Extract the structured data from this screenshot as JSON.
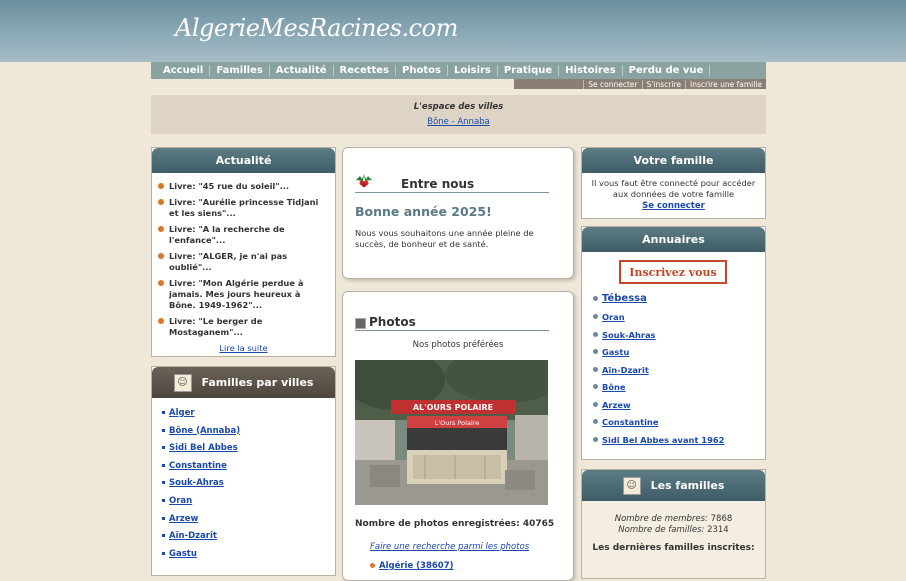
{
  "site": {
    "logo": "AlgerieMesRacines.com"
  },
  "nav": {
    "items": [
      "Accueil",
      "Familles",
      "Actualité",
      "Recettes",
      "Photos",
      "Loisirs",
      "Pratique",
      "Histoires",
      "Perdu de vue"
    ],
    "sub_items": [
      "Se connecter",
      "S'inscrire",
      "Inscrire une famille"
    ]
  },
  "city_band": {
    "title": "L'espace des villes",
    "link": "Bône - Annaba"
  },
  "actualite": {
    "title": "Actualité",
    "items": [
      "Livre: \"45 rue du soleil\"...",
      "Livre: \"Aurélie princesse Tidjani et les siens\"...",
      "Livre: \"A la recherche de l'enfance\"...",
      "Livre: \"ALGER, je n'ai pas oublié\"...",
      "Livre: \"Mon Algérie perdue à jamais. Mes jours heureux à Bône. 1949-1962\"...",
      "Livre: \"Le berger de Mostaganem\"..."
    ],
    "read_more": "Lire la suite"
  },
  "familles_villes": {
    "title": "Familles par villes",
    "items": [
      "Alger",
      "Bône (Annaba)",
      "Sidi Bel Abbes",
      "Constantine",
      "Souk-Ahras",
      "Oran",
      "Arzew",
      "Aïn-Dzarit",
      "Gastu"
    ]
  },
  "entre_nous": {
    "title": "Entre nous",
    "heading": "Bonne année 2025!",
    "text": "Nous vous souhaitons une année pleine de succès, de bonheur et de santé."
  },
  "photos": {
    "title": "Photos",
    "subtitle": "Nos photos préférées",
    "sign_top": "AL'OURS POLAIRE",
    "sign_mid": "L'Ours Polaire",
    "count_label": "Nombre de photos enregistrées: 40765",
    "search_link": "Faire une recherche parmi les photos",
    "region": "Algérie (38607)"
  },
  "votre_famille": {
    "title": "Votre famille",
    "text": "Il vous faut être connecté pour accéder aux données de votre famille",
    "link": "Se connecter"
  },
  "annuaires": {
    "title": "Annuaires",
    "banner": "Inscrivez vous",
    "featured": "Tébessa",
    "items": [
      "Oran",
      "Souk-Ahras",
      "Gastu",
      "Aïn-Dzarit",
      "Bône",
      "Arzew",
      "Constantine",
      "Sidi Bel Abbes avant 1962"
    ]
  },
  "les_familles": {
    "title": "Les familles",
    "members_label": "Nombre de membres:",
    "members_value": "7868",
    "families_label": "Nombre de familles:",
    "families_value": "2314",
    "latest": "Les dernières familles inscrites:"
  },
  "colors": {
    "header_bar": "#4a6a74",
    "link": "#1a4aa8",
    "nav": "#8aa3a0",
    "background": "#efe7d8"
  }
}
